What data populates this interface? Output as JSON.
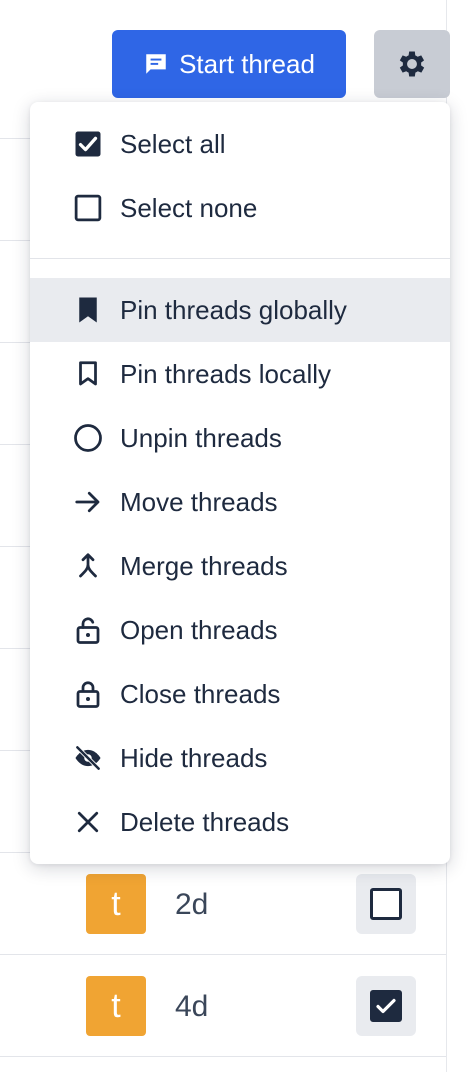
{
  "toolbar": {
    "start_thread_label": "Start thread",
    "start_thread_icon": "chat-bubble-icon",
    "settings_icon": "gear-icon",
    "accent_color": "#2f66e6"
  },
  "menu": {
    "selection": [
      {
        "label": "Select all",
        "icon": "checkbox-checked-icon"
      },
      {
        "label": "Select none",
        "icon": "checkbox-empty-icon"
      }
    ],
    "actions": [
      {
        "label": "Pin threads globally",
        "icon": "bookmark-filled-icon"
      },
      {
        "label": "Pin threads locally",
        "icon": "bookmark-outline-icon"
      },
      {
        "label": "Unpin threads",
        "icon": "circle-icon"
      },
      {
        "label": "Move threads",
        "icon": "arrow-right-icon"
      },
      {
        "label": "Merge threads",
        "icon": "merge-icon"
      },
      {
        "label": "Open threads",
        "icon": "lock-open-icon"
      },
      {
        "label": "Close threads",
        "icon": "lock-icon"
      },
      {
        "label": "Hide threads",
        "icon": "eye-slash-icon"
      },
      {
        "label": "Delete threads",
        "icon": "close-icon"
      }
    ]
  },
  "threads": [
    {
      "avatar_letter": "t",
      "age": "2d",
      "selected": false,
      "avatar_color": "#f0a433"
    },
    {
      "avatar_letter": "t",
      "age": "4d",
      "selected": true,
      "avatar_color": "#f0a433"
    }
  ]
}
